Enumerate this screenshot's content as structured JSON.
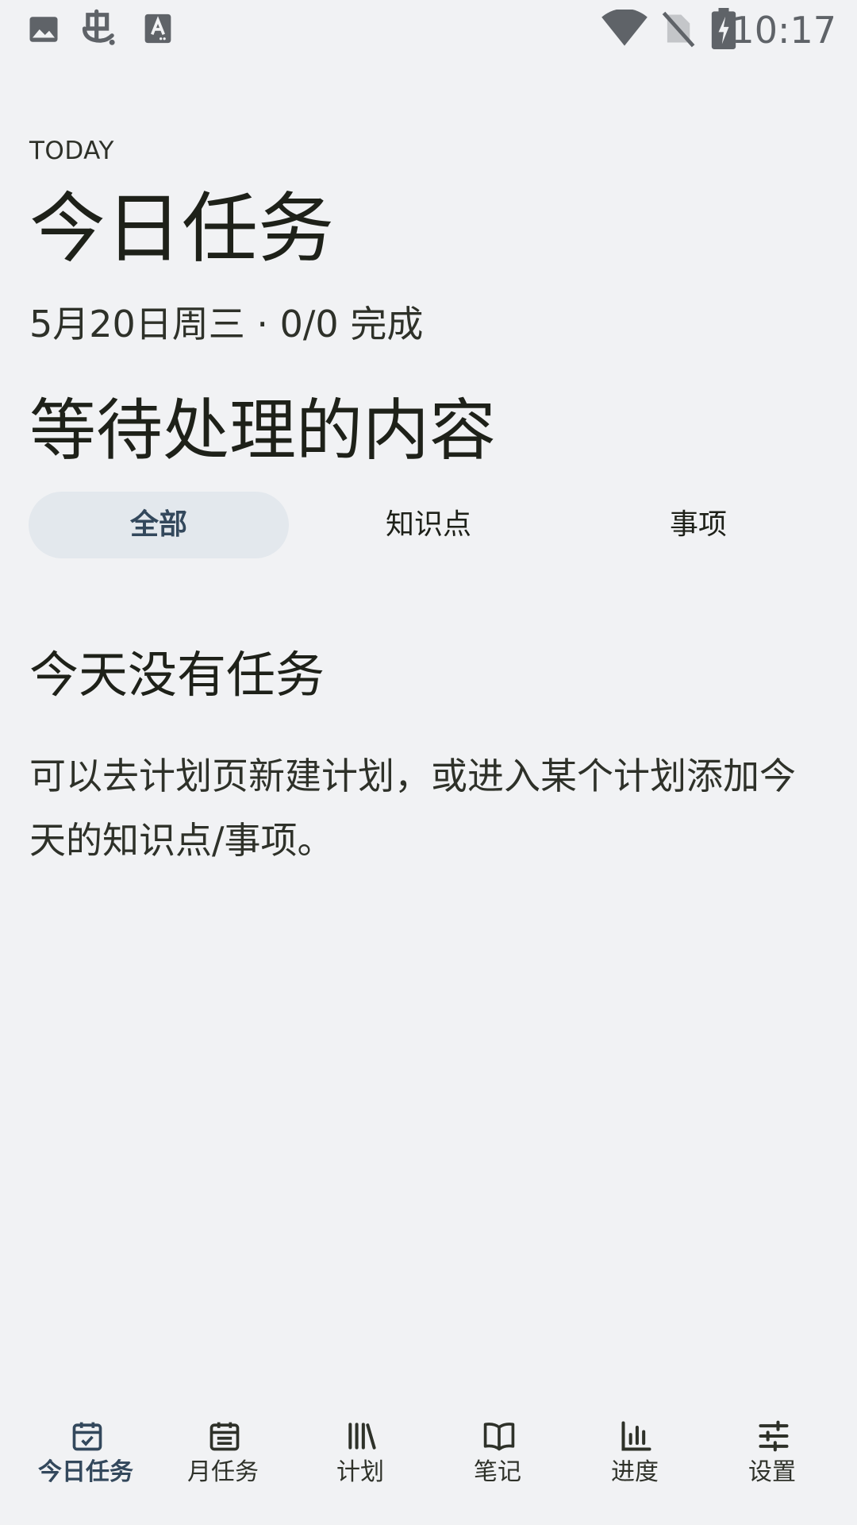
{
  "status_bar": {
    "time": "10:17",
    "icons": [
      "image-icon",
      "app-logo-icon",
      "accessibility-icon",
      "wifi-icon",
      "no-sim-icon",
      "battery-charging-icon"
    ]
  },
  "header": {
    "eyebrow": "TODAY",
    "title": "今日任务",
    "subtitle": "5月20日周三 · 0/0 完成"
  },
  "pending": {
    "title": "等待处理的内容",
    "tabs": [
      {
        "label": "全部",
        "active": true
      },
      {
        "label": "知识点",
        "active": false
      },
      {
        "label": "事项",
        "active": false
      }
    ]
  },
  "empty_state": {
    "title": "今天没有任务",
    "description": "可以去计划页新建计划，或进入某个计划添加今天的知识点/事项。"
  },
  "bottom_nav": {
    "items": [
      {
        "label": "今日任务",
        "icon": "calendar-check-icon",
        "active": true
      },
      {
        "label": "月任务",
        "icon": "calendar-month-icon",
        "active": false
      },
      {
        "label": "计划",
        "icon": "library-icon",
        "active": false
      },
      {
        "label": "笔记",
        "icon": "book-open-icon",
        "active": false
      },
      {
        "label": "进度",
        "icon": "bar-chart-icon",
        "active": false
      },
      {
        "label": "设置",
        "icon": "sliders-icon",
        "active": false
      }
    ]
  },
  "colors": {
    "background": "#f1f2f4",
    "accent": "#33485c",
    "active_tab_bg": "#e3e8ed",
    "text": "#1e2119",
    "status_icon": "#5f6368"
  }
}
